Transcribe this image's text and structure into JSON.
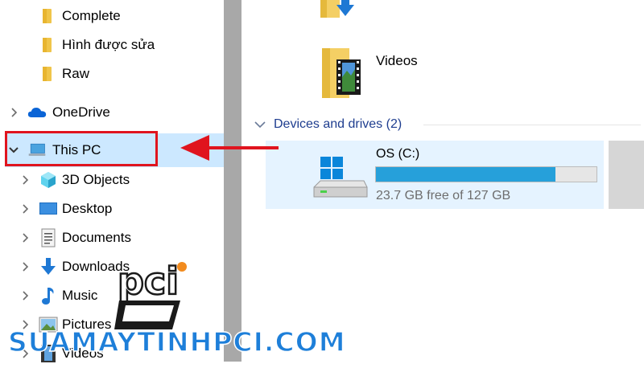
{
  "sidebar": {
    "items": [
      {
        "label": "Complete",
        "icon": "folder-icon",
        "expandable": false
      },
      {
        "label": "Hình được sửa",
        "icon": "folder-icon",
        "expandable": false
      },
      {
        "label": "Raw",
        "icon": "folder-icon",
        "expandable": false
      },
      {
        "label": "OneDrive",
        "icon": "onedrive-cloud-icon",
        "expandable": true
      },
      {
        "label": "This PC",
        "icon": "computer-icon",
        "expandable": true,
        "expanded": true,
        "selected": true
      },
      {
        "label": "3D Objects",
        "icon": "3d-objects-icon",
        "expandable": true
      },
      {
        "label": "Desktop",
        "icon": "desktop-icon",
        "expandable": true
      },
      {
        "label": "Documents",
        "icon": "documents-icon",
        "expandable": true
      },
      {
        "label": "Downloads",
        "icon": "downloads-icon",
        "expandable": true
      },
      {
        "label": "Music",
        "icon": "music-icon",
        "expandable": true
      },
      {
        "label": "Pictures",
        "icon": "pictures-icon",
        "expandable": true
      },
      {
        "label": "Videos",
        "icon": "videos-icon",
        "expandable": true
      }
    ]
  },
  "main": {
    "folders": [
      {
        "label": "Videos",
        "icon": "videos-folder-icon"
      }
    ],
    "devices_section": {
      "title": "Devices and drives (2)"
    },
    "drives": [
      {
        "name": "OS (C:)",
        "free_text": "23.7 GB free of 127 GB",
        "used_fraction": 0.813
      }
    ]
  },
  "watermark": {
    "logo_text": "pci",
    "site_text": "SUAMAYTINHPCI.COM"
  },
  "colors": {
    "selection": "#cce8ff",
    "highlight_box": "#e0141e",
    "arrow": "#e0141e",
    "drive_bar_fill": "#26a0da",
    "section_header": "#1e3d8f",
    "watermark_blue": "#1e7fd9"
  }
}
